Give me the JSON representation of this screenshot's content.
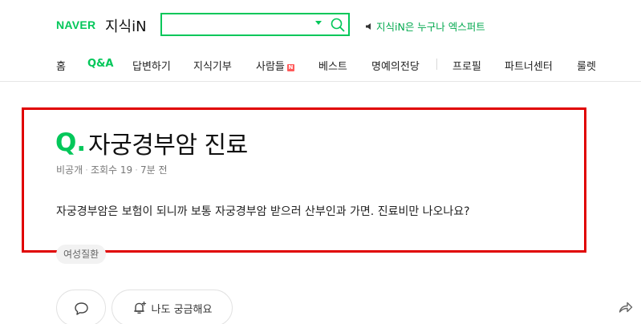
{
  "header": {
    "logo_brand": "NAVER",
    "logo_service": "지식iN",
    "search": {
      "value": "",
      "placeholder": ""
    },
    "notice": "지식iN은 누구나 엑스퍼트",
    "accent_color": "#03c75a"
  },
  "nav": {
    "items": [
      {
        "label": "홈",
        "active": false
      },
      {
        "label": "Q&A",
        "active": true
      },
      {
        "label": "답변하기",
        "active": false
      },
      {
        "label": "지식기부",
        "active": false
      },
      {
        "label": "사람들",
        "active": false,
        "badge": "N"
      },
      {
        "label": "베스트",
        "active": false
      },
      {
        "label": "명예의전당",
        "active": false
      },
      {
        "label": "프로필",
        "active": false
      },
      {
        "label": "파트너센터",
        "active": false
      },
      {
        "label": "룰렛",
        "active": false
      }
    ]
  },
  "question": {
    "q_label": "Q.",
    "title": "자궁경부암 진료",
    "author": "비공개",
    "views": "조회수 19",
    "time": "7분 전",
    "body": "자궁경부암은 보험이 되니까 보통 자궁경부암 받으러 산부인과 가면. 진료비만 나오나요?",
    "tag": "여성질환"
  },
  "actions": {
    "curious_label": "나도 궁금해요"
  },
  "highlight_color": "#e00000"
}
